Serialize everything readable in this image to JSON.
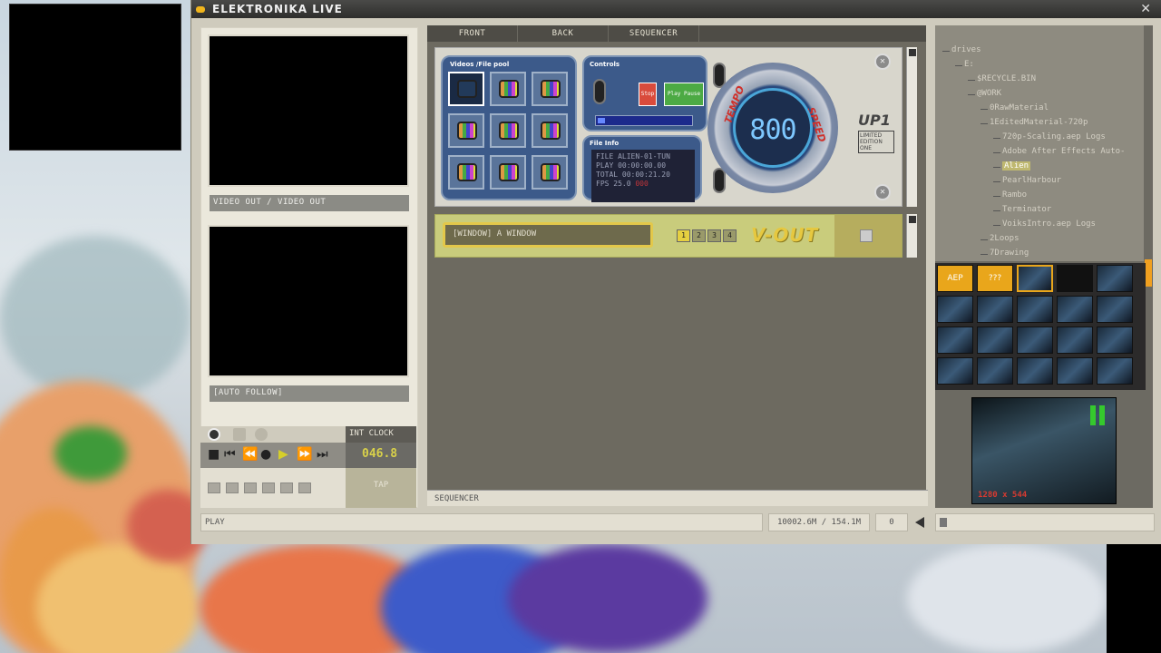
{
  "window": {
    "title": "ELEKTRONIKA LIVE",
    "close_glyph": "✕"
  },
  "left": {
    "video1_label": "VIDEO OUT / VIDEO OUT",
    "video2_label": "[AUTO FOLLOW]",
    "int_clock_label": "INT CLOCK",
    "clock_value": "046.8",
    "tap_label": "TAP"
  },
  "tabs": [
    "FRONT",
    "BACK",
    "SEQUENCER"
  ],
  "front": {
    "videos_caption": "Videos /File pool",
    "controls_caption": "Controls",
    "stop_label": "Stop",
    "play_pause_label": "Play Pause",
    "fileinfo_caption": "File Info",
    "fileinfo": {
      "file": "FILE ALIEN-01-TUN",
      "play": "PLAY   00:00:00.00",
      "total": "TOTAL  00:00:21.20",
      "fps": "FPS 25.0",
      "fps_extra": "000"
    },
    "dial_digits": "800",
    "dial_left": "TEMPO",
    "dial_right": "SPEED",
    "logo_big": "UP1",
    "logo_small": "LIMITED EDITION ONE"
  },
  "vout": {
    "window_field": "[WINDOW] A WINDOW",
    "numbers": [
      "1",
      "2",
      "3",
      "4"
    ],
    "title": "V-OUT"
  },
  "sequencer_label": "SEQUENCER",
  "tree": {
    "items": [
      {
        "label": "drives",
        "indent": 0
      },
      {
        "label": "E:",
        "indent": 1
      },
      {
        "label": "$RECYCLE.BIN",
        "indent": 2
      },
      {
        "label": "@WORK",
        "indent": 2
      },
      {
        "label": "0RawMaterial",
        "indent": 3
      },
      {
        "label": "1EditedMaterial-720p",
        "indent": 3
      },
      {
        "label": "720p-Scaling.aep Logs",
        "indent": 4
      },
      {
        "label": "Adobe After Effects Auto-",
        "indent": 4
      },
      {
        "label": "Alien",
        "indent": 4,
        "selected": true
      },
      {
        "label": "PearlHarbour",
        "indent": 4
      },
      {
        "label": "Rambo",
        "indent": 4
      },
      {
        "label": "Terminator",
        "indent": 4
      },
      {
        "label": "VoiksIntro.aep Logs",
        "indent": 4
      },
      {
        "label": "2Loops",
        "indent": 3
      },
      {
        "label": "7Drawing",
        "indent": 3
      }
    ]
  },
  "grid": {
    "label1": "AEP",
    "label2": "???"
  },
  "preview": {
    "resolution": "1280 x 544"
  },
  "status": {
    "mode": "PLAY",
    "memory": "10002.6M / 154.1M",
    "counter": "0"
  },
  "colors": {
    "accent": "#e9a61b",
    "title_bar": "#3a3a38",
    "panel": "#6d6a60",
    "vout_bg": "#c9cc7c"
  }
}
